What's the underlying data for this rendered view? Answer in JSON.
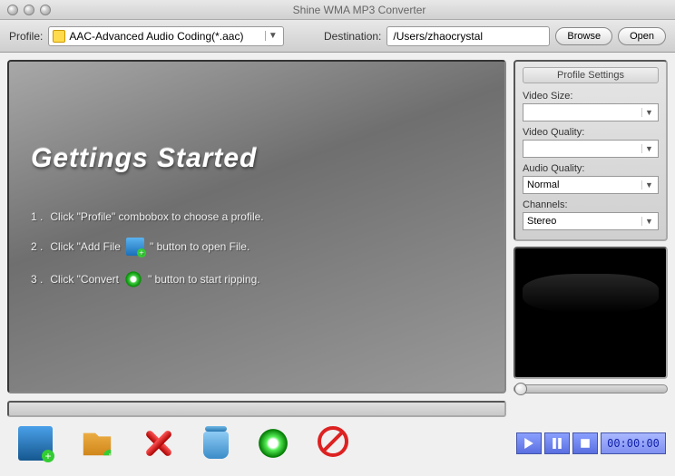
{
  "window": {
    "title": "Shine WMA MP3 Converter"
  },
  "toolbar": {
    "profile_label": "Profile:",
    "profile_value": "AAC-Advanced Audio Coding(*.aac)",
    "destination_label": "Destination:",
    "destination_value": "/Users/zhaocrystal",
    "browse": "Browse",
    "open": "Open"
  },
  "guide": {
    "heading": "Gettings Started",
    "steps": [
      {
        "n": "1 .",
        "pre": "Click \"Profile\" combobox to choose a profile."
      },
      {
        "n": "2 .",
        "pre": "Click \"Add File",
        "post": "\" button to open File."
      },
      {
        "n": "3 .",
        "pre": "Click \"Convert",
        "post": "\" button to start ripping."
      }
    ]
  },
  "settings": {
    "title": "Profile Settings",
    "video_size_label": "Video Size:",
    "video_size_value": "",
    "video_quality_label": "Video Quality:",
    "video_quality_value": "",
    "audio_quality_label": "Audio Quality:",
    "audio_quality_value": "Normal",
    "channels_label": "Channels:",
    "channels_value": "Stereo"
  },
  "player": {
    "time": "00:00:00"
  }
}
